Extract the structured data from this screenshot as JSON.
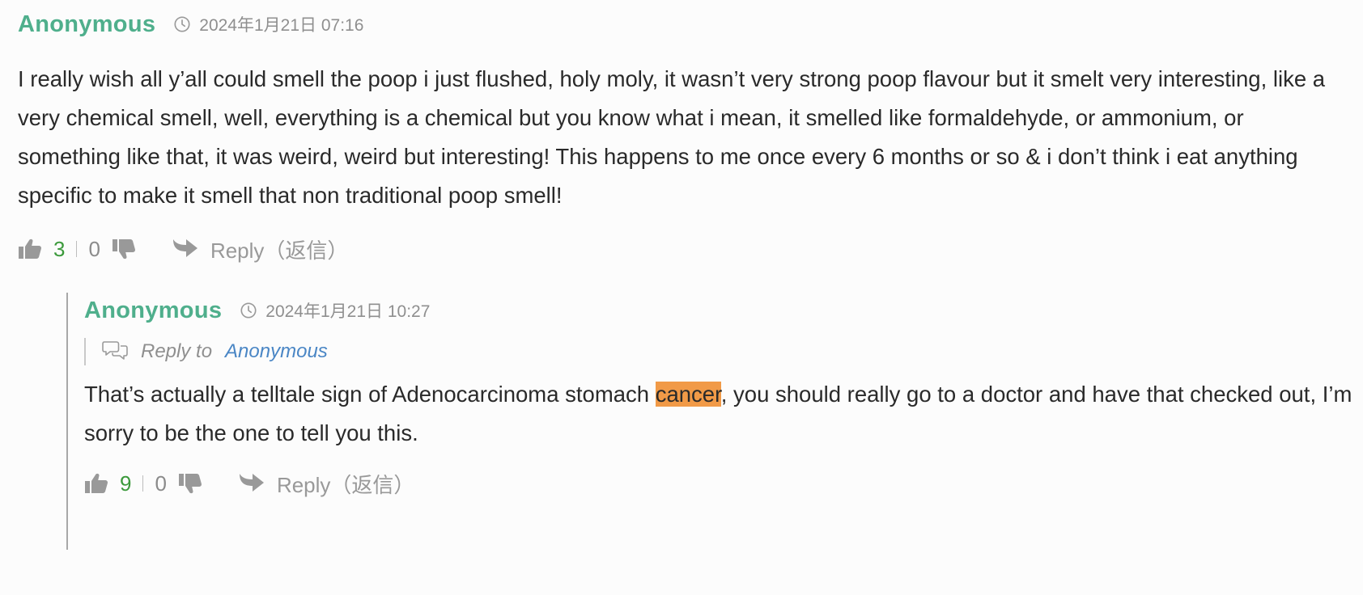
{
  "comments": [
    {
      "author": "Anonymous",
      "date": "2024年1月21日 07:16",
      "text": "I really wish all y’all could smell the poop i just flushed, holy moly, it wasn’t very strong poop flavour but it smelt very interesting, like a very chemical smell, well, everything is a chemical but you know what i mean, it smelled like formaldehyde, or ammonium, or something like that, it was weird, weird but interesting! This happens to me once every 6 months or so & i don’t think i eat anything specific to make it smell that non traditional poop smell!",
      "upvotes": "3",
      "downvotes": "0",
      "reply_label": "Reply（返信）"
    },
    {
      "author": "Anonymous",
      "date": "2024年1月21日 10:27",
      "reply_to_label": "Reply to",
      "reply_to_name": "Anonymous",
      "text_before": "That’s actually a telltale sign of Adenocarcinoma stomach ",
      "text_highlight": "cancer",
      "text_after": ", you should really go to a doctor and have that checked out, I’m sorry to be the one to tell you this.",
      "upvotes": "9",
      "downvotes": "0",
      "reply_label": "Reply（返信）"
    }
  ],
  "colors": {
    "author": "#4faf8c",
    "upvote_count": "#3c9a3c",
    "reply_to_name": "#4a86c5",
    "highlight": "#f19a47",
    "muted": "#8f8f8f"
  },
  "icons": [
    "clock-icon",
    "thumbs-up-icon",
    "thumbs-down-icon",
    "reply-arrow-icon",
    "speech-bubbles-icon"
  ]
}
